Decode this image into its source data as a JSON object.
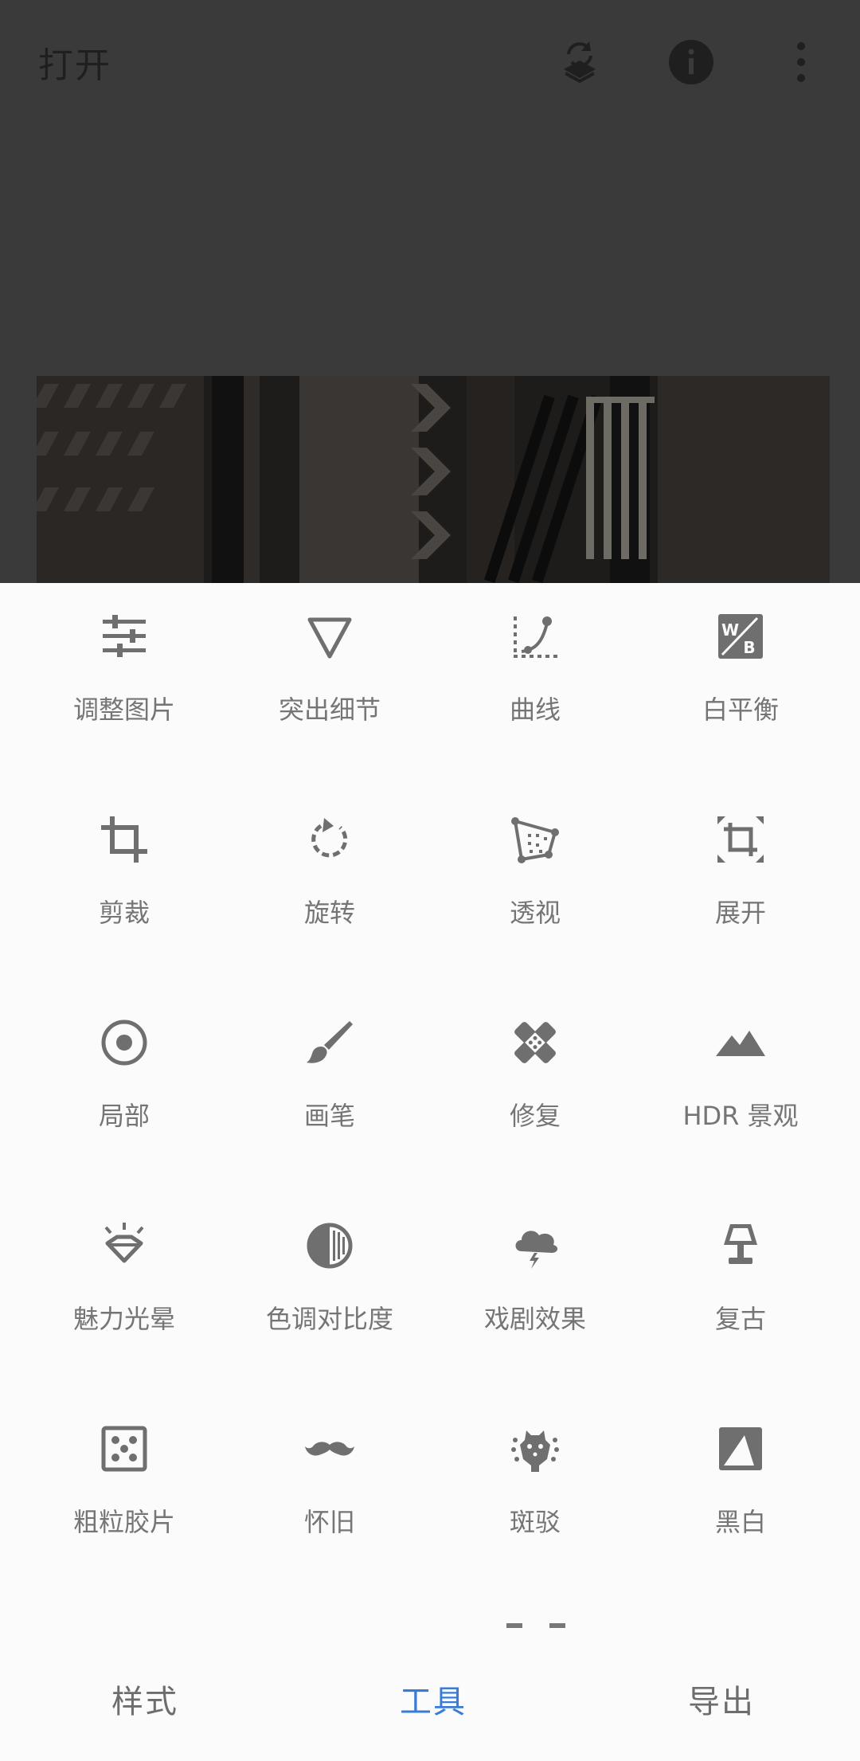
{
  "header": {
    "open_label": "打开",
    "icons": [
      "stacks-undo-icon",
      "info-icon",
      "more-vert-icon"
    ]
  },
  "tools": [
    {
      "label": "调整图片",
      "icon": "tune-icon"
    },
    {
      "label": "突出细节",
      "icon": "details-triangle-icon"
    },
    {
      "label": "曲线",
      "icon": "curves-icon"
    },
    {
      "label": "白平衡",
      "icon": "white-balance-icon"
    },
    {
      "label": "剪裁",
      "icon": "crop-icon"
    },
    {
      "label": "旋转",
      "icon": "rotate-icon"
    },
    {
      "label": "透视",
      "icon": "perspective-icon"
    },
    {
      "label": "展开",
      "icon": "expand-icon"
    },
    {
      "label": "局部",
      "icon": "selective-icon"
    },
    {
      "label": "画笔",
      "icon": "brush-icon"
    },
    {
      "label": "修复",
      "icon": "healing-icon"
    },
    {
      "label": "HDR 景观",
      "icon": "hdr-mountains-icon"
    },
    {
      "label": "魅力光晕",
      "icon": "glamour-glow-icon"
    },
    {
      "label": "色调对比度",
      "icon": "tonal-contrast-icon"
    },
    {
      "label": "戏剧效果",
      "icon": "drama-cloud-icon"
    },
    {
      "label": "复古",
      "icon": "vintage-lamp-icon"
    },
    {
      "label": "粗粒胶片",
      "icon": "grainy-film-icon"
    },
    {
      "label": "怀旧",
      "icon": "retrolux-mustache-icon"
    },
    {
      "label": "斑驳",
      "icon": "grunge-icon"
    },
    {
      "label": "黑白",
      "icon": "black-white-icon"
    }
  ],
  "bottom_nav": {
    "styles": "样式",
    "tools": "工具",
    "export": "导出",
    "active": "tools"
  },
  "colors": {
    "accent": "#3a7bd5",
    "icon": "#6f6f6f",
    "label": "#757575",
    "overlay": "#3a3a3a",
    "sheet": "#fbfbfb"
  }
}
